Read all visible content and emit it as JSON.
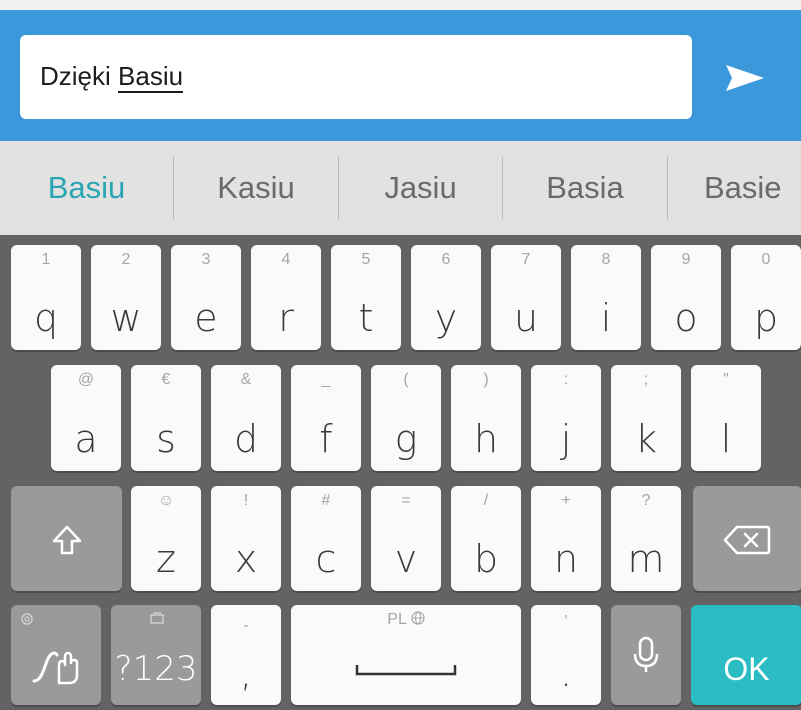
{
  "compose": {
    "text_prefix": "Dzięki ",
    "text_word": "Basiu"
  },
  "suggestions": [
    "Basiu",
    "Kasiu",
    "Jasiu",
    "Basia",
    "Basie"
  ],
  "keyboard": {
    "row1": [
      {
        "hint": "1",
        "label": "q"
      },
      {
        "hint": "2",
        "label": "w"
      },
      {
        "hint": "3",
        "label": "e"
      },
      {
        "hint": "4",
        "label": "r"
      },
      {
        "hint": "5",
        "label": "t"
      },
      {
        "hint": "6",
        "label": "y"
      },
      {
        "hint": "7",
        "label": "u"
      },
      {
        "hint": "8",
        "label": "i"
      },
      {
        "hint": "9",
        "label": "o"
      },
      {
        "hint": "0",
        "label": "p"
      }
    ],
    "row2": [
      {
        "hint": "@",
        "label": "a"
      },
      {
        "hint": "€",
        "label": "s"
      },
      {
        "hint": "&",
        "label": "d"
      },
      {
        "hint": "_",
        "label": "f"
      },
      {
        "hint": "(",
        "label": "g"
      },
      {
        "hint": ")",
        "label": "h"
      },
      {
        "hint": ":",
        "label": "j"
      },
      {
        "hint": ";",
        "label": "k"
      },
      {
        "hint": "\"",
        "label": "l"
      }
    ],
    "row3": [
      {
        "hint": "☺",
        "label": "z"
      },
      {
        "hint": "!",
        "label": "x"
      },
      {
        "hint": "#",
        "label": "c"
      },
      {
        "hint": "=",
        "label": "v"
      },
      {
        "hint": "/",
        "label": "b"
      },
      {
        "hint": "+",
        "label": "n"
      },
      {
        "hint": "?",
        "label": "m"
      }
    ],
    "symbols_label": "?123",
    "comma_hint": "-",
    "comma_label": ",",
    "space_hint": "PL",
    "period_hint": "'",
    "period_label": ".",
    "ok_label": "OK",
    "icons": {
      "shift": "shift-icon",
      "backspace": "backspace-icon",
      "gesture": "gesture-hand-icon",
      "settings": "settings-gear-icon",
      "clipboard": "clipboard-icon",
      "globe": "globe-icon",
      "mic": "microphone-icon",
      "send": "send-icon"
    }
  },
  "colors": {
    "compose_bar": "#3a98db",
    "suggestion_active": "#2aa5b4",
    "ok_key": "#2bbdc3"
  }
}
